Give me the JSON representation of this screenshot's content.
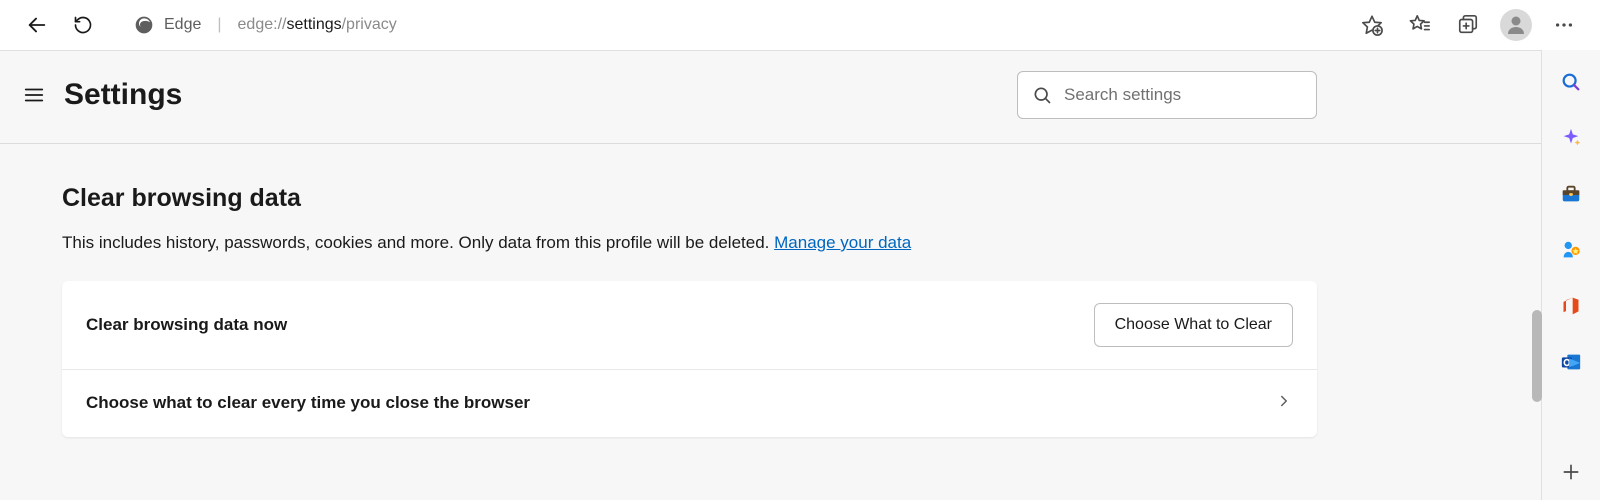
{
  "toolbar": {
    "app_name": "Edge",
    "url_prefix": "edge://",
    "url_bold": "settings",
    "url_suffix": "/privacy"
  },
  "header": {
    "title": "Settings",
    "search_placeholder": "Search settings"
  },
  "section": {
    "title": "Clear browsing data",
    "description": "This includes history, passwords, cookies and more. Only data from this profile will be deleted. ",
    "link_text": "Manage your data",
    "rows": [
      {
        "label": "Clear browsing data now",
        "button_label": "Choose What to Clear"
      },
      {
        "label": "Choose what to clear every time you close the browser"
      }
    ]
  }
}
